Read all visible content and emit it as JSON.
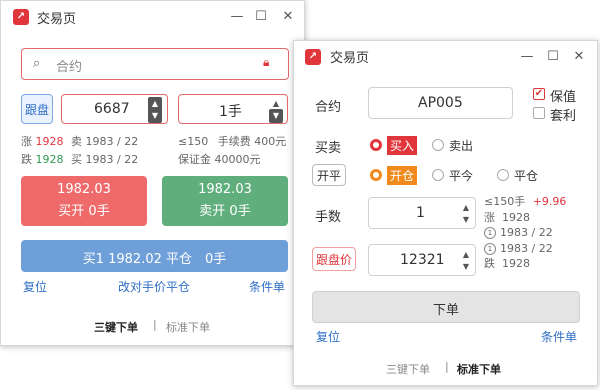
{
  "win1": {
    "title": "交易页",
    "search_placeholder": "合约",
    "follow_btn": "跟盘",
    "price": "6687",
    "qty": "1手",
    "info": {
      "zhang_label": "涨",
      "zhang_val": "1928",
      "mai_label": "卖",
      "mai_val": "1983 / 22",
      "die_label": "跌",
      "die_val": "1928",
      "mai2_label": "买",
      "mai2_val": "1983 / 22",
      "limit": "≤150",
      "fee_label": "手续费",
      "fee_val": "400元",
      "margin_label": "保证金",
      "margin_val": "40000元"
    },
    "buy_price": "1982.03",
    "buy_label": "买开 0手",
    "sell_price": "1982.03",
    "sell_label": "卖开 0手",
    "close_btn": "买1 1982.02 平仓　0手",
    "reset": "复位",
    "change_close": "改对手价平仓",
    "cond": "条件单",
    "tab_three": "三键下单",
    "tab_std": "标准下单"
  },
  "win2": {
    "title": "交易页",
    "contract_label": "合约",
    "contract_val": "AP005",
    "opt_hedge": "保值",
    "opt_arb": "套利",
    "bs_label": "买卖",
    "buy": "买入",
    "sell": "卖出",
    "oc_label": "开平",
    "open": "开仓",
    "close_today": "平今",
    "close": "平仓",
    "qty_label": "手数",
    "qty_val": "1",
    "limit": "≤150手",
    "change": "+9.96",
    "zhang_label": "涨",
    "zhang_val": "1928",
    "q1": "1983 / 22",
    "q2": "1983 / 22",
    "die_label": "跌",
    "die_val": "1928",
    "follow_label": "跟盘价",
    "price_val": "12321",
    "order_btn": "下单",
    "reset": "复位",
    "cond": "条件单",
    "tab_three": "三键下单",
    "tab_std": "标准下单"
  }
}
